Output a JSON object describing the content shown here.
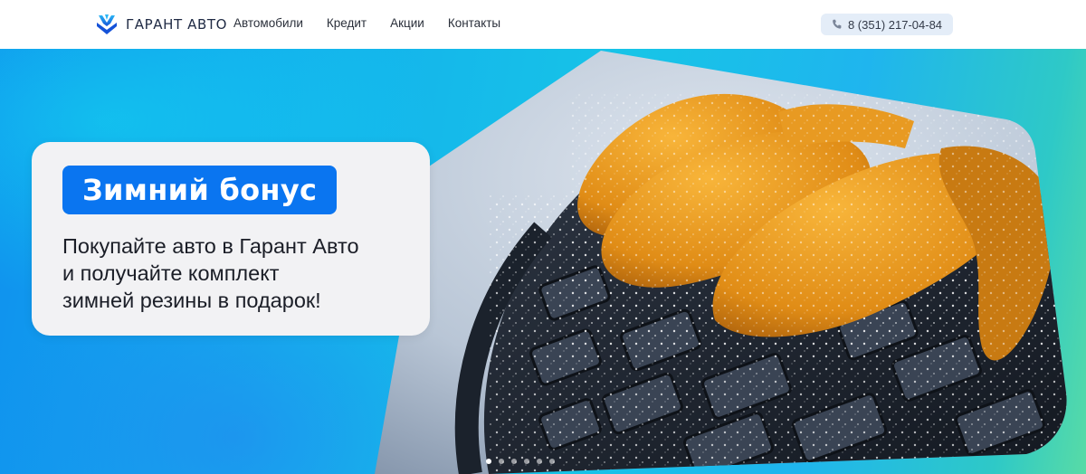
{
  "header": {
    "logo_text": "ГАРАНТ АВТО",
    "nav": [
      {
        "label": "Автомобили"
      },
      {
        "label": "Кредит"
      },
      {
        "label": "Акции"
      },
      {
        "label": "Контакты"
      }
    ],
    "phone": "8 (351) 217-04-84",
    "phone_icon": "phone-icon"
  },
  "hero": {
    "badge": "Зимний бонус",
    "text_lines": [
      "Покупайте авто в Гарант Авто",
      "и получайте комплект",
      "зимней резины в подарок!"
    ],
    "slides_total": 6,
    "active_slide": 1,
    "image_subject": "snow-covered winter tire with orange gloves"
  },
  "colors": {
    "accent": "#0a75f0",
    "hero_gradient_start": "#0f8fee",
    "hero_gradient_end": "#58dba6",
    "glove_orange": "#f0a020"
  }
}
